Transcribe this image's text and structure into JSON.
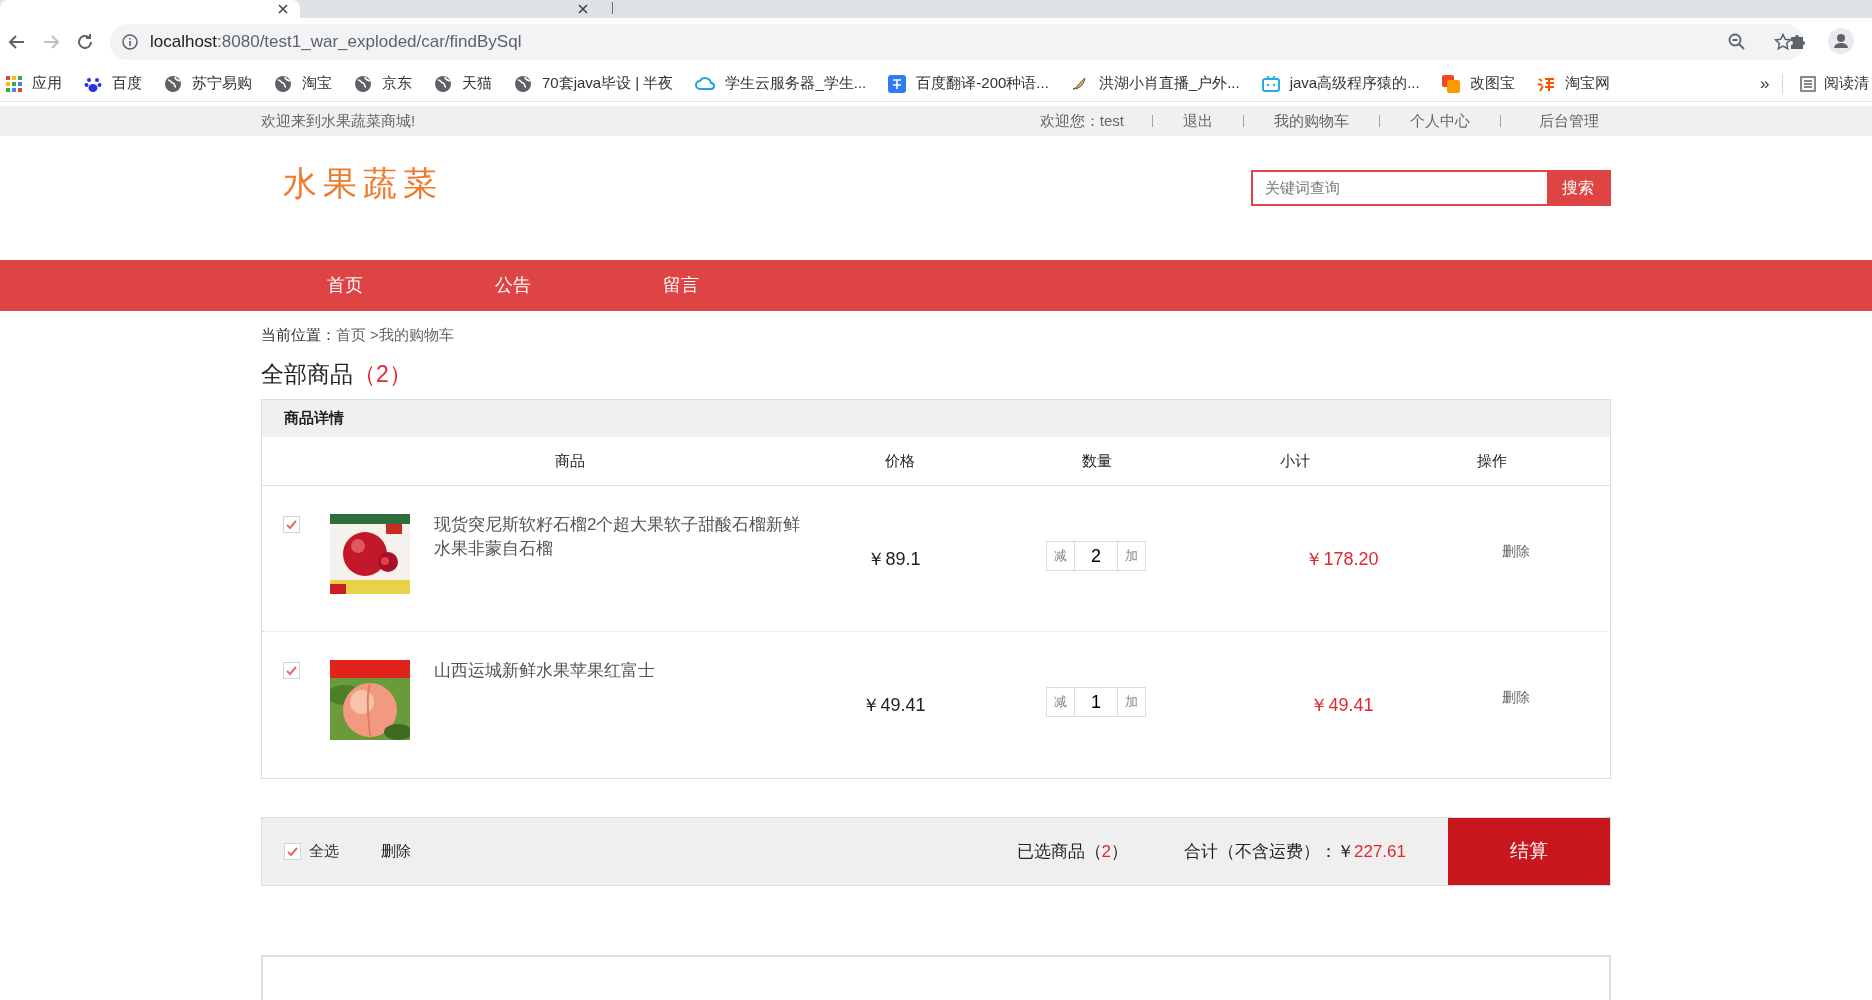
{
  "browser": {
    "tabs": [
      {
        "selected": true
      },
      {
        "selected": false
      }
    ],
    "url_host": "localhost",
    "url_rest": ":8080/test1_war_exploded/car/findBySql",
    "bookmarks": [
      "应用",
      "百度",
      "苏宁易购",
      "淘宝",
      "京东",
      "天猫",
      "70套java毕设 | 半夜",
      "学生云服务器_学生...",
      "百度翻译-200种语...",
      "洪湖小肖直播_户外...",
      "java高级程序猿的...",
      "改图宝",
      "淘宝网"
    ],
    "more": "»",
    "reading_list": "阅读清"
  },
  "topbar": {
    "welcome": "欢迎来到水果蔬菜商城!",
    "user_greeting": "欢迎您：test",
    "links": [
      "退出",
      "我的购物车",
      "个人中心",
      "后台管理"
    ]
  },
  "header": {
    "logo": "水果蔬菜",
    "search": {
      "placeholder": "关键词查询",
      "button": "搜索"
    }
  },
  "nav": [
    "首页",
    "公告",
    "留言"
  ],
  "breadcrumb": {
    "label": "当前位置：",
    "home": "首页",
    "current": ">我的购物车"
  },
  "heading": {
    "title": "全部商品",
    "count": "（2）"
  },
  "cart": {
    "section_title": "商品详情",
    "columns": [
      "商品",
      "价格",
      "数量",
      "小计",
      "操作"
    ],
    "items": [
      {
        "checked": true,
        "name": "现货突尼斯软籽石榴2个超大果软子甜酸石榴新鲜水果非蒙自石榴",
        "price": "￥89.1",
        "minus": "减",
        "quantity": "2",
        "plus": "加",
        "subtotal": "￥178.20",
        "action": "删除"
      },
      {
        "checked": true,
        "name": "山西运城新鲜水果苹果红富士",
        "price": "￥49.41",
        "minus": "减",
        "quantity": "1",
        "plus": "加",
        "subtotal": "￥49.41",
        "action": "删除"
      }
    ]
  },
  "footer_bar": {
    "select_all": {
      "checked": true,
      "label": "全选"
    },
    "delete": "删除",
    "selected_label": "已选商品（",
    "selected_count": "2",
    "selected_end": "）",
    "total_label": "合计（不含运费）：￥",
    "total": "227.61",
    "checkout": "结算"
  }
}
